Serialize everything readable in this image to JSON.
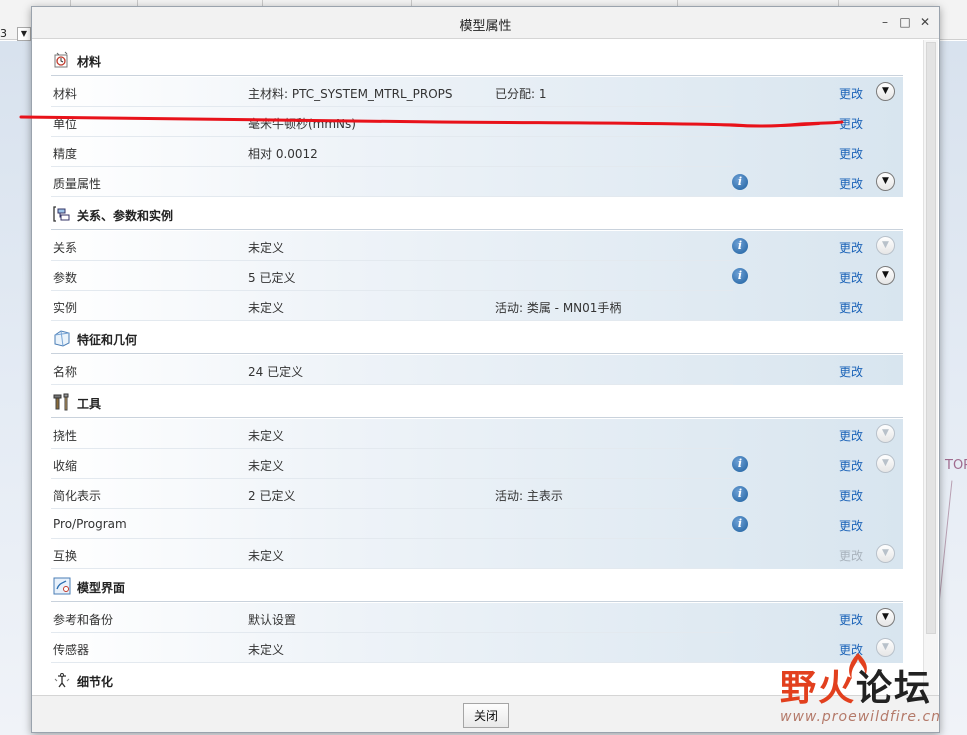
{
  "background": {
    "toolbar_number": "3",
    "side_tag": "TOP"
  },
  "dialog": {
    "title": "模型属性",
    "minimize_glyph": "–",
    "maximize_glyph": "□",
    "close_glyph": "✕",
    "close_button_label": "关闭"
  },
  "colors": {
    "link": "#1b63b8",
    "link_disabled": "#a9b3bd",
    "annotation": "#e8121a",
    "info_icon": "#2a6db0"
  },
  "sections": [
    {
      "title": "材料",
      "icon": "material-icon",
      "rows": [
        {
          "label": "材料",
          "value": "主材料: PTC_SYSTEM_MTRL_PROPS",
          "extra": "已分配: 1",
          "info": false,
          "change": "更改",
          "change_enabled": true,
          "expand": "enabled"
        },
        {
          "label": "单位",
          "value": "毫米牛顿秒(mmNs)",
          "extra": "",
          "info": false,
          "change": "更改",
          "change_enabled": true,
          "expand": "none"
        },
        {
          "label": "精度",
          "value": "相对 0.0012",
          "extra": "",
          "info": false,
          "change": "更改",
          "change_enabled": true,
          "expand": "none"
        },
        {
          "label": "质量属性",
          "value": "",
          "extra": "",
          "info": true,
          "change": "更改",
          "change_enabled": true,
          "expand": "enabled"
        }
      ]
    },
    {
      "title": "关系、参数和实例",
      "icon": "relations-icon",
      "rows": [
        {
          "label": "关系",
          "value": "未定义",
          "extra": "",
          "info": true,
          "change": "更改",
          "change_enabled": true,
          "expand": "disabled"
        },
        {
          "label": "参数",
          "value": "5 已定义",
          "extra": "",
          "info": true,
          "change": "更改",
          "change_enabled": true,
          "expand": "enabled"
        },
        {
          "label": "实例",
          "value": "未定义",
          "extra": "活动: 类属 - MN01手柄",
          "info": false,
          "change": "更改",
          "change_enabled": true,
          "expand": "none"
        }
      ]
    },
    {
      "title": "特征和几何",
      "icon": "features-icon",
      "rows": [
        {
          "label": "名称",
          "value": "24 已定义",
          "extra": "",
          "info": false,
          "change": "更改",
          "change_enabled": true,
          "expand": "none"
        }
      ]
    },
    {
      "title": "工具",
      "icon": "tools-icon",
      "rows": [
        {
          "label": "挠性",
          "value": "未定义",
          "extra": "",
          "info": false,
          "change": "更改",
          "change_enabled": true,
          "expand": "disabled"
        },
        {
          "label": "收缩",
          "value": "未定义",
          "extra": "",
          "info": true,
          "change": "更改",
          "change_enabled": true,
          "expand": "disabled"
        },
        {
          "label": "简化表示",
          "value": "2 已定义",
          "extra": "活动: 主表示",
          "info": true,
          "change": "更改",
          "change_enabled": true,
          "expand": "none"
        },
        {
          "label": "Pro/Program",
          "value": "",
          "extra": "",
          "info": true,
          "change": "更改",
          "change_enabled": true,
          "expand": "none"
        },
        {
          "label": "互换",
          "value": "未定义",
          "extra": "",
          "info": false,
          "change": "更改",
          "change_enabled": false,
          "expand": "disabled"
        }
      ]
    },
    {
      "title": "模型界面",
      "icon": "model-interface-icon",
      "rows": [
        {
          "label": "参考和备份",
          "value": "默认设置",
          "extra": "",
          "info": false,
          "change": "更改",
          "change_enabled": true,
          "expand": "enabled"
        },
        {
          "label": "传感器",
          "value": "未定义",
          "extra": "",
          "info": false,
          "change": "更改",
          "change_enabled": true,
          "expand": "disabled"
        }
      ]
    },
    {
      "title": "细节化",
      "icon": "detailing-icon",
      "rows": []
    }
  ],
  "watermark": {
    "logo_text_1": "野火",
    "logo_text_2": "论坛",
    "url": "www.proewildfire.cn"
  }
}
